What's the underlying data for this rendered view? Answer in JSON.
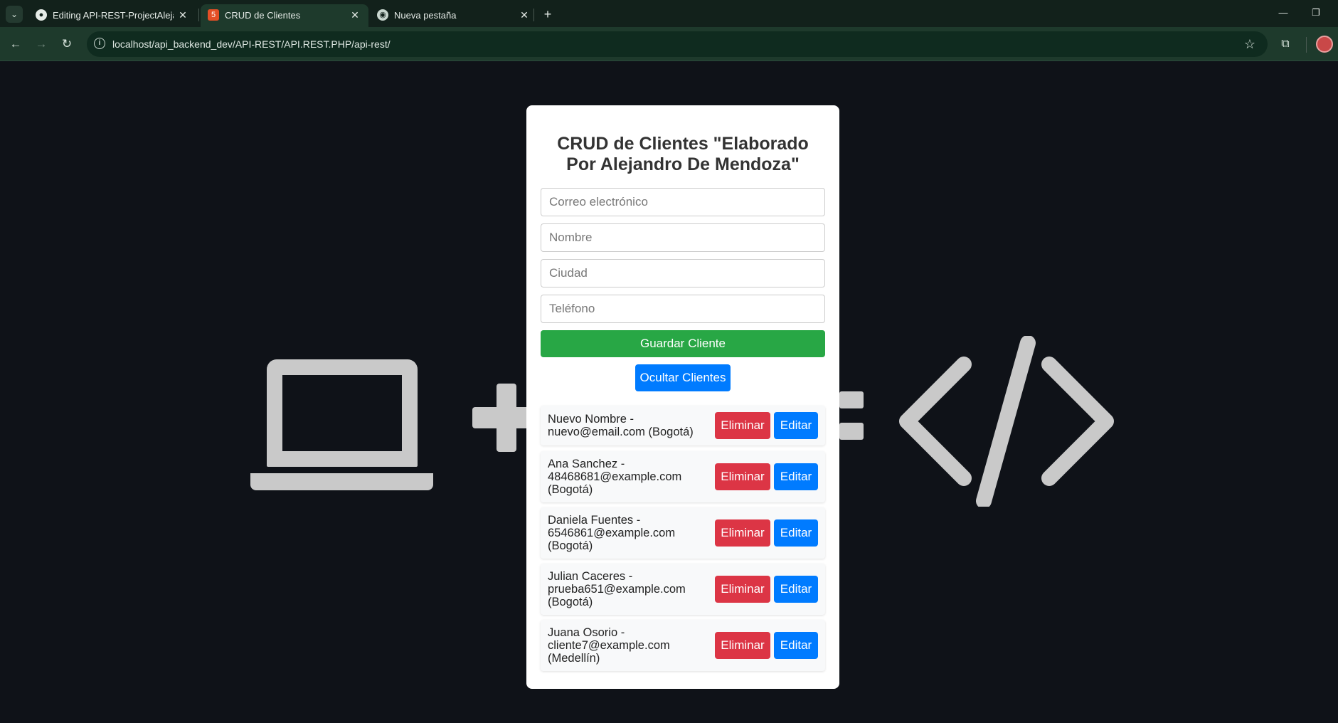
{
  "browser": {
    "tabs": [
      {
        "title": "Editing API-REST-ProjectAlejandro",
        "icon": "github-icon",
        "active": false
      },
      {
        "title": "CRUD de Clientes",
        "icon": "html5-icon",
        "active": true
      },
      {
        "title": "Nueva pestaña",
        "icon": "chrome-icon",
        "active": false
      }
    ],
    "url": "localhost/api_backend_dev/API-REST/API.REST.PHP/api-rest/"
  },
  "card": {
    "title": "CRUD de Clientes \"Elaborado Por Alejandro De Mendoza\"",
    "fields": {
      "email_placeholder": "Correo electrónico",
      "name_placeholder": "Nombre",
      "city_placeholder": "Ciudad",
      "phone_placeholder": "Teléfono"
    },
    "save_label": "Guardar Cliente",
    "toggle_label": "Ocultar Clientes",
    "delete_label": "Eliminar",
    "edit_label": "Editar"
  },
  "clients": [
    {
      "text": "Nuevo Nombre - nuevo@email.com (Bogotá)"
    },
    {
      "text": "Ana Sanchez - 48468681@example.com (Bogotá)"
    },
    {
      "text": "Daniela Fuentes - 6546861@example.com (Bogotá)"
    },
    {
      "text": "Julian Caceres - prueba651@example.com (Bogotá)"
    },
    {
      "text": "Juana Osorio - cliente7@example.com (Medellín)"
    }
  ],
  "colors": {
    "save": "#28a745",
    "primary": "#007bff",
    "danger": "#dc3545",
    "page_bg": "#0f1218"
  }
}
